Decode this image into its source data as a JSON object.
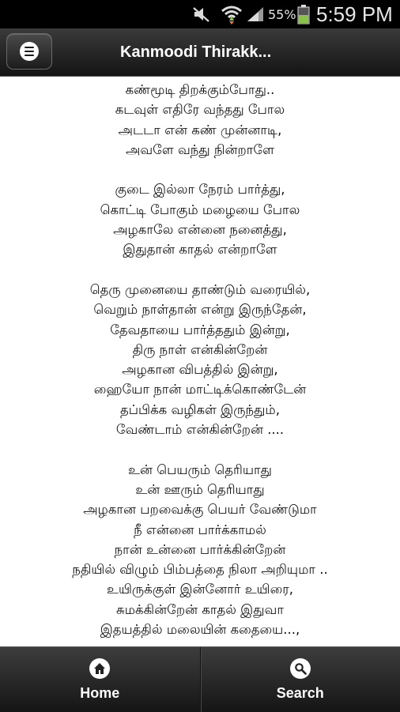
{
  "status_bar": {
    "battery_percent": "55%",
    "time": "5:59 PM",
    "icons": [
      "mute-icon",
      "wifi-icon",
      "signal-icon",
      "battery-icon"
    ]
  },
  "action_bar": {
    "title": "Kanmoodi Thirakk...",
    "menu_icon": "menu-icon"
  },
  "lyrics": {
    "stanzas": [
      [
        "கண்மூடி திறக்கும்போது..",
        "கடவுள் எதிரே வந்தது போல",
        "அடடா என் கண் முன்னாடி,",
        "அவளே வந்து நின்றாளே"
      ],
      [
        "குடை இல்லா நேரம் பார்த்து,",
        "கொட்டி போகும் மழையை போல",
        "அழகாலே என்னை நனைத்து,",
        "இதுதான் காதல் என்றாளே"
      ],
      [
        "தெரு முனையை தாண்டும் வரையில்,",
        "வெறும் நாள்தான் என்று இருந்தேன்,",
        "தேவதாயை பார்த்ததும் இன்று,",
        "திரு நாள் என்கின்றேன்",
        "அழகான விபத்தில் இன்று,",
        "ஹையோ நான் மாட்டிக்கொண்டேன்",
        "தப்பிக்க வழிகள் இருந்தும்,",
        "வேண்டாம் என்கின்றேன் ...."
      ],
      [
        "உன் பெயரும் தெரியாது",
        "உன் ஊரும் தெரியாது",
        "அழகான பறவைக்கு பெயர் வேண்டுமா",
        "நீ என்னை பார்க்காமல்",
        "நான் உன்னை பார்க்கின்றேன்",
        "நதியில் விழும் பிம்பத்தை நிலா அறியுமா ..",
        "உயிருக்குள் இன்னோர் உயிரை,",
        "சுமக்கின்றேன் காதல் இதுவா",
        "இதயத்தில் மலையின் கதையை...,"
      ]
    ]
  },
  "bottom_nav": {
    "home": {
      "label": "Home",
      "icon": "home-icon"
    },
    "search": {
      "label": "Search",
      "icon": "search-icon"
    }
  },
  "colors": {
    "status_bar_bg": "#000000",
    "action_bar_bg": "#2a2a2a",
    "content_bg": "#ffffff",
    "text": "#111111",
    "battery_green": "#8bc34a"
  }
}
